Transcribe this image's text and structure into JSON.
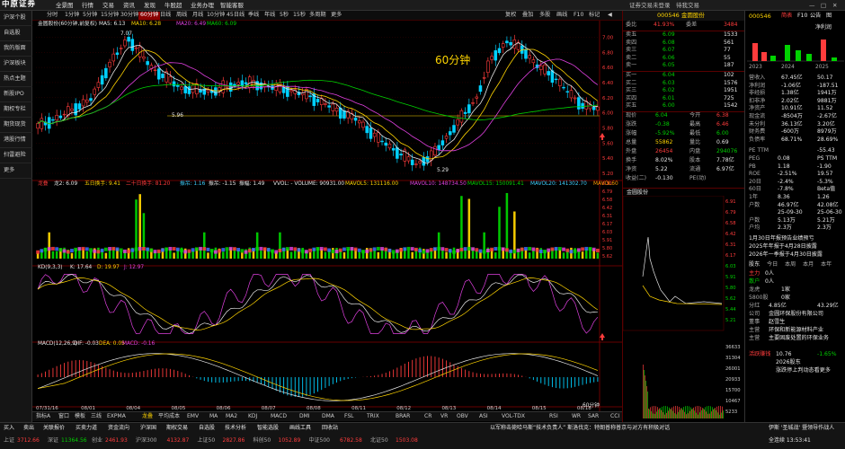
{
  "app": {
    "logo": "中原证券",
    "menu": [
      "全景图",
      "行情",
      "交易",
      "资讯",
      "发现",
      "牛股超",
      "业务办理",
      "智能客服"
    ],
    "top_right": [
      "证券交易未登录",
      "待我交易"
    ],
    "window_controls": [
      "—",
      "□",
      "✕"
    ]
  },
  "sidebar": {
    "items": [
      "沪深个股",
      "自选股",
      "我的版面",
      "沪深板块",
      "热点主题",
      "新股IPO",
      "期权专栏",
      "期货现货",
      "港股行情",
      "扫雷避险",
      "更多"
    ]
  },
  "period_bar": {
    "items": [
      "分时",
      "1分钟",
      "5分钟",
      "15分钟",
      "30分钟",
      "60分钟",
      "日线",
      "周线",
      "月线",
      "10分钟",
      "45日线",
      "季线",
      "年线",
      "5秒",
      "15秒",
      "多周期",
      "更多"
    ],
    "active_index": 5,
    "right_items": [
      "复权",
      "叠加",
      "多股",
      "画线",
      "F10",
      "标记",
      "◀"
    ]
  },
  "chart": {
    "title": "金圆股份(60分钟,前复权)",
    "ma": {
      "MA5": "MA5: 6.13",
      "MA10": "MA10: 6.28",
      "MA20": "MA20: 6.49",
      "MA60": "MA60: 6.09"
    },
    "overlay_label": "60分钟",
    "high_label": "7.07",
    "low_label": "5.29",
    "mark_label": "5.96",
    "price_ticks": [
      "7.00",
      "6.80",
      "6.60",
      "6.40",
      "6.20",
      "6.00",
      "5.80",
      "5.60",
      "5.40",
      "5.20"
    ],
    "vol_legend": {
      "lb": "龙叠",
      "lb2": "龙2: 6.09",
      "a": "五日换手: 9.41",
      "b": "二十日换手: 81.20",
      "c": "振吊: 1.16",
      "d": "振吊: -1.15",
      "e": "振幅: 1.49",
      "f": "VVOL: - VOLUME: 90931.00",
      "g": "MAVOL5: 131116.00",
      "h": "MAVOL10: 148734.50",
      "i": "MAVOL15: 150091.41",
      "j": "MAVOL20: 141302.70",
      "k": "MAVOL60"
    },
    "kd_legend": {
      "name": "KD(9,3,3)",
      "k": "K: 17.64",
      "d": "D: 19.97",
      "j": "J: 12.97"
    },
    "macd_legend": {
      "name": "MACD(12,26,9)",
      "dif": "DIF: -0.03",
      "dea": "DEA: 0.05",
      "macd": "MACD: -0.16"
    },
    "time_labels": [
      "07/31/16",
      "08/01",
      "08/04",
      "08/05",
      "08/06",
      "08/07",
      "08/08",
      "08/11",
      "08/12",
      "08/13",
      "08/14",
      "08/15",
      "08/18"
    ],
    "minute_label": "60分钟"
  },
  "chart_data": {
    "type": "candlestick",
    "x": [
      "07/31",
      "08/01",
      "08/04",
      "08/05",
      "08/06",
      "08/07",
      "08/08",
      "08/11",
      "08/12",
      "08/13",
      "08/14",
      "08/15",
      "08/18"
    ],
    "ohlc_hint": "60-minute bars",
    "high": 7.07,
    "low": 5.29,
    "last": 6.09,
    "ylim": [
      5.2,
      7.1
    ]
  },
  "bottom_tabs": {
    "items": [
      "指标A",
      "窗口",
      "模板",
      "三线",
      "EXPMA",
      "龙叠",
      "平均成本",
      "EMV",
      "MA",
      "MA2",
      "KDJ",
      "MACD",
      "DMI",
      "DMA",
      "FSL",
      "TRIX",
      "BRAR",
      "CR",
      "VR",
      "OBV",
      "ASI",
      "VOL-TDX",
      "RSI",
      "WR",
      "SAR",
      "CCI",
      "ROC",
      "MTM",
      "BOLL",
      "PSY",
      "MCST",
      "龙线",
      "筹码"
    ],
    "selected": "龙叠"
  },
  "ticker": {
    "row1": [
      "买入",
      "卖出",
      "关联报价",
      "买卖力道",
      "资金流向",
      "沪深国",
      "期权交易",
      "自选股",
      "技术分析",
      "智能选股",
      "画线工具",
      "回收站"
    ],
    "row2": [
      {
        "t": "上证",
        "v": "3712.66",
        "c": "r"
      },
      {
        "t": "深证",
        "v": "11364.56",
        "c": "g"
      },
      {
        "t": "创业",
        "v": "2461.93",
        "c": "r"
      },
      {
        "t": "沪深300",
        "v": "4132.87",
        "c": "r"
      },
      {
        "t": "上证50",
        "v": "2827.86",
        "c": "r"
      },
      {
        "t": "科创50",
        "v": "1052.89",
        "c": "r"
      },
      {
        "t": "中证500",
        "v": "6782.58",
        "c": "r"
      },
      {
        "t": "北证50",
        "v": "1503.08",
        "c": "r"
      }
    ],
    "news": "以军称击毙哈马斯“技术负责人” 斯洛伐克：特朗普称普京与对方有积极对话",
    "right": [
      "伊斯 '圣城战' 暨领导作战人",
      "全连续 13:53:41"
    ]
  },
  "quote": {
    "code": "000546",
    "name": "金圆股份",
    "ratio_label": "委比",
    "ratio_val": "41.93%",
    "diff_label": "委差",
    "diff_val": "3484",
    "sells": [
      {
        "l": "卖五",
        "p": "6.09",
        "v": "1533"
      },
      {
        "l": "卖四",
        "p": "6.08",
        "v": "561"
      },
      {
        "l": "卖三",
        "p": "6.07",
        "v": "77"
      },
      {
        "l": "卖二",
        "p": "6.06",
        "v": "55"
      },
      {
        "l": "卖一",
        "p": "6.05",
        "v": "187"
      }
    ],
    "buys": [
      {
        "l": "买一",
        "p": "6.04",
        "v": "102"
      },
      {
        "l": "买二",
        "p": "6.03",
        "v": "1576"
      },
      {
        "l": "买三",
        "p": "6.02",
        "v": "1951"
      },
      {
        "l": "买四",
        "p": "6.01",
        "v": "725"
      },
      {
        "l": "买五",
        "p": "6.00",
        "v": "1542"
      }
    ],
    "stats": [
      {
        "l": "现价",
        "v": "6.04",
        "c": "g",
        "l2": "今开",
        "v2": "6.38",
        "c2": "r"
      },
      {
        "l": "涨跌",
        "v": "-0.38",
        "c": "g",
        "l2": "最高",
        "v2": "6.46",
        "c2": "r"
      },
      {
        "l": "涨幅",
        "v": "-5.92%",
        "c": "g",
        "l2": "最低",
        "v2": "6.00",
        "c2": "g"
      },
      {
        "l": "总量",
        "v": "55862",
        "c": "y",
        "l2": "量比",
        "v2": "0.69",
        "c2": "w"
      },
      {
        "l": "外盘",
        "v": "26454",
        "c": "r",
        "l2": "内盘",
        "v2": "294076",
        "c2": "g"
      },
      {
        "l": "换手",
        "v": "8.02%",
        "c": "w",
        "l2": "股本",
        "v2": "7.78亿",
        "c2": "w"
      },
      {
        "l": "净资",
        "v": "5.22",
        "c": "w",
        "l2": "流通",
        "v2": "6.97亿",
        "c2": "w"
      },
      {
        "l": "收益(二)",
        "v": "-0.130",
        "c": "w",
        "l2": "PE(动)",
        "v2": "",
        "c2": "w"
      }
    ],
    "mini_title": "金圆股份",
    "mini_ticks": [
      "6.91",
      "6.79",
      "6.58",
      "6.42",
      "6.31",
      "6.17",
      "6.03",
      "5.91",
      "5.80",
      "5.62",
      "5.44",
      "5.21"
    ],
    "mini_vol_ticks": [
      "36633",
      "31304",
      "26001",
      "20933",
      "15700",
      "10467",
      "5233"
    ]
  },
  "fin": {
    "code": "000546",
    "tabs": [
      "简表",
      "F10",
      "公告",
      "图"
    ],
    "chart_title": "净利润",
    "chart_years": [
      "2023",
      "2024",
      "2025"
    ],
    "rows": [
      {
        "l": "营收入",
        "v": "67.45亿",
        "v2": "50.17"
      },
      {
        "l": "净利润",
        "v": "-1.06亿",
        "v2": "-187.51"
      },
      {
        "l": "非经损",
        "v": "1.38亿",
        "v2": "1941万"
      },
      {
        "l": "扣非净",
        "v": "2.02亿",
        "v2": "9881万"
      },
      {
        "l": "净资产",
        "v": "10.91亿",
        "v2": "11.52"
      },
      {
        "l": "现金流",
        "v": "-8504万",
        "v2": "-2.67亿"
      },
      {
        "l": "未分利",
        "v": "36.13亿",
        "v2": "3.20亿"
      },
      {
        "l": "财务费",
        "v": "-600万",
        "v2": "8979万"
      },
      {
        "l": "负债率",
        "v": "68.71%",
        "v2": "28.69%"
      }
    ],
    "rows2": [
      {
        "l": "PE TTM",
        "v": "",
        "v2": "-55.43"
      },
      {
        "l": "PEG",
        "v": "0.08",
        "v2": "PS TTM"
      },
      {
        "l": "PB",
        "v": "1.18",
        "v2": "-1.90"
      },
      {
        "l": "ROE",
        "v": "-2.51%",
        "v2": "19.57"
      },
      {
        "l": "20日",
        "v": "-2.4%",
        "v2": "-5.3%"
      },
      {
        "l": "60日",
        "v": "-7.8%",
        "v2": "Beta值"
      },
      {
        "l": "1年",
        "v": "8.36",
        "v2": "1.26"
      },
      {
        "l": "户数",
        "v": "46.97亿",
        "v2": "42.08亿"
      },
      {
        "l": "",
        "v": "25-09-30",
        "v2": "25-06-30"
      },
      {
        "l": "户数",
        "v": "5.13万",
        "v2": "5.21万"
      },
      {
        "l": "户均",
        "v": "2.3万",
        "v2": "2.3万"
      }
    ],
    "notes": [
      "1月30日年报预告业绩预亏",
      "2025年年报于4月28日披露",
      "2026年一季报于4月30日披露"
    ],
    "tabs2": [
      "股东",
      "今日",
      "本周",
      "本月",
      "本年"
    ],
    "flow": [
      {
        "l": "主力",
        "v": "0人"
      },
      {
        "l": "散户",
        "v": "0人"
      }
    ],
    "lhb": [
      {
        "l": "龙虎",
        "v": "1家"
      },
      {
        "l": "5800股",
        "v": "0家"
      }
    ],
    "rows3": [
      {
        "l": "分红",
        "v": "4.85亿",
        "v2": "43.29亿"
      },
      {
        "l": "公司",
        "v": "金圆环保股份有限公司"
      },
      {
        "l": "董事",
        "v": "赵雪生"
      },
      {
        "l": "主营",
        "v": "环保和新能源材料产业"
      },
      {
        "l": "主营",
        "v": "主要固废处置的环保业务"
      },
      {
        "l": "",
        "v": "",
        "v2": ""
      }
    ],
    "bottom": [
      {
        "l": "活跃赚钱",
        "v": "10.76",
        "v2": "-1.65%"
      },
      {
        "l": "",
        "v": "2026股东",
        "v2": ""
      },
      {
        "l": "",
        "v": "涨跌停上判动态看更多",
        "v2": ""
      }
    ]
  }
}
